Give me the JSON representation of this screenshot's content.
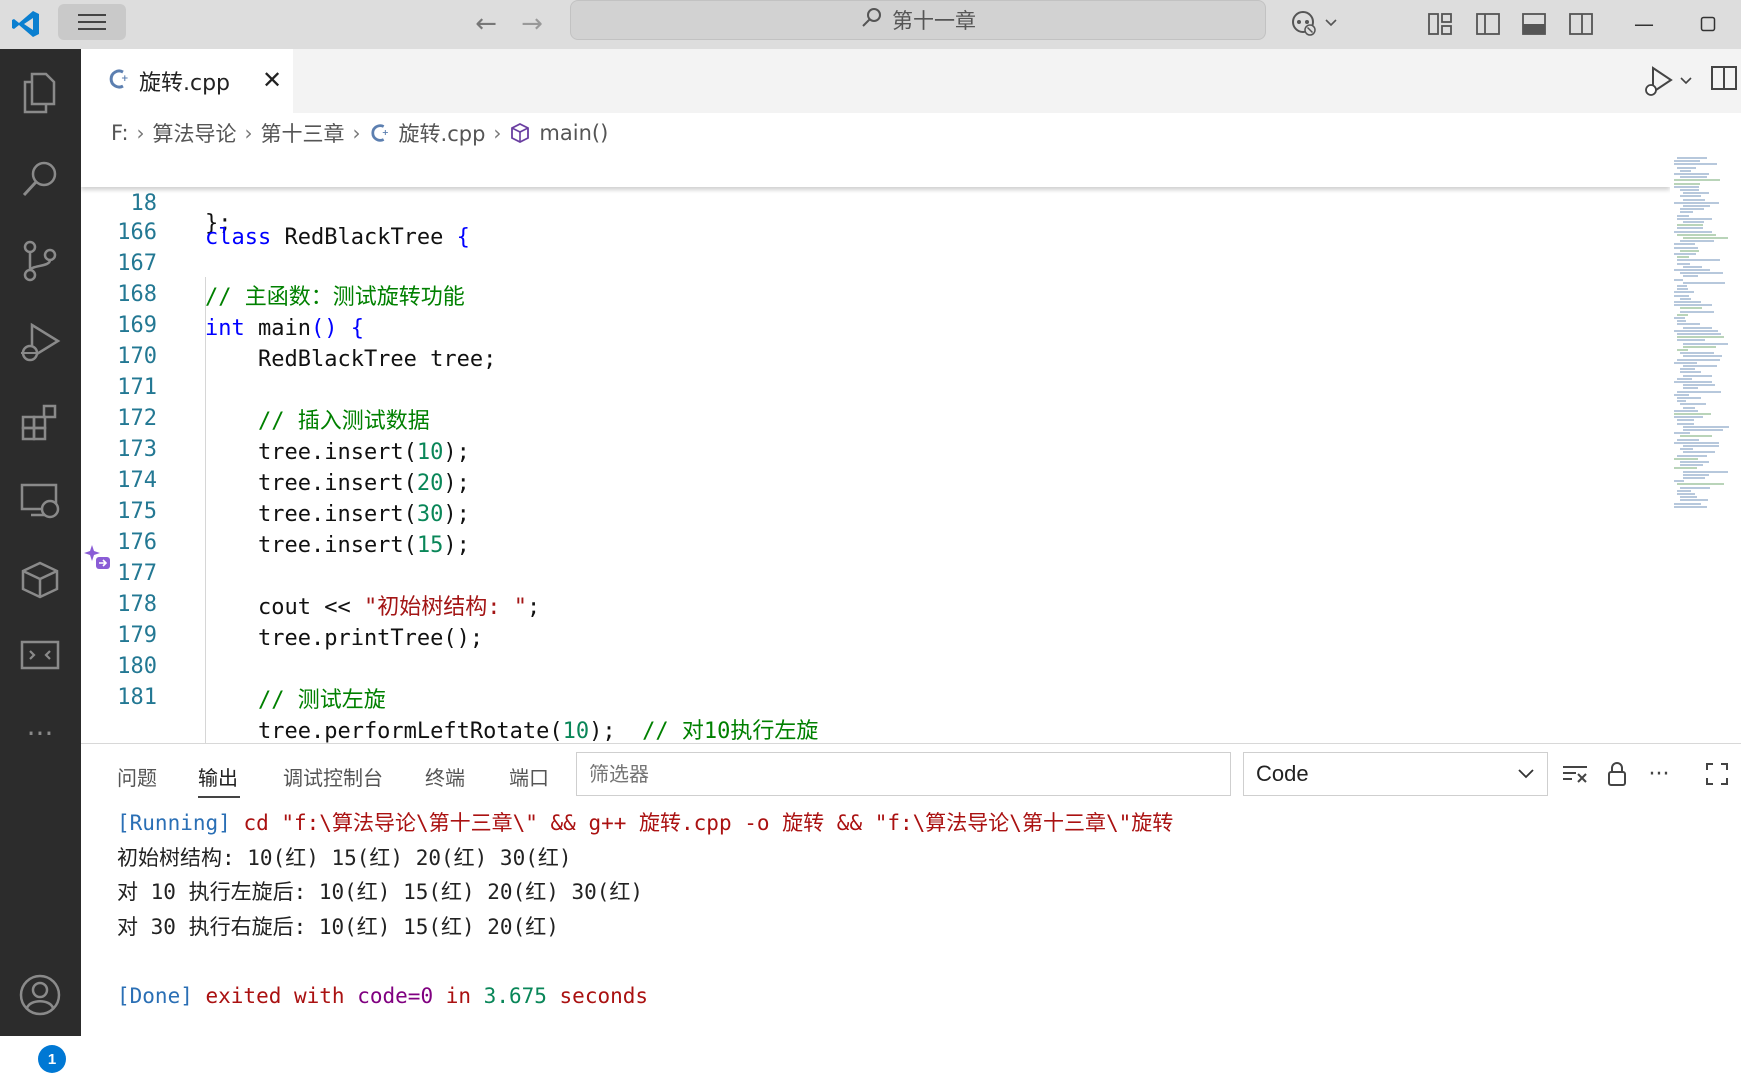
{
  "titlebar": {
    "search_text": "第十一章",
    "icons": [
      "vscode-logo",
      "menu-icon",
      "arrow-left-icon",
      "arrow-right-icon",
      "search-icon",
      "copilot-icon",
      "customize-layout-icon",
      "toggle-sidebar-icon",
      "toggle-panel-icon",
      "toggle-secondary-sidebar-icon",
      "minimize-icon",
      "maximize-icon"
    ]
  },
  "activitybar": {
    "items": [
      "explorer-icon",
      "search-icon",
      "source-control-icon",
      "run-debug-icon",
      "extensions-icon",
      "remote-explorer-icon",
      "containers-icon",
      "remote-window-icon",
      "more-icon",
      "accounts-icon"
    ],
    "accounts_badge": "1"
  },
  "tab": {
    "label": "旋转.cpp",
    "close": "✕"
  },
  "breadcrumb": {
    "drive": "F:",
    "folder1": "算法导论",
    "folder2": "第十三章",
    "file": "旋转.cpp",
    "symbol": "main()"
  },
  "editor": {
    "sticky": {
      "ln": "18",
      "kw": "class",
      "text": " RedBlackTree ",
      "brace": "{"
    },
    "lines": [
      {
        "ln": "166"
      },
      {
        "ln": "167",
        "comment": "// 主函数：测试旋转功能"
      },
      {
        "ln": "168",
        "kw": "int",
        "text": " main",
        "tail": "() {"
      },
      {
        "ln": "169",
        "text": "    RedBlackTree tree;"
      },
      {
        "ln": "170"
      },
      {
        "ln": "171",
        "comment": "    // 插入测试数据"
      },
      {
        "ln": "172",
        "pre": "    tree.insert(",
        "num": "10",
        "post": ");"
      },
      {
        "ln": "173",
        "pre": "    tree.insert(",
        "num": "20",
        "post": ");"
      },
      {
        "ln": "174",
        "pre": "    tree.insert(",
        "num": "30",
        "post": ");"
      },
      {
        "ln": "175",
        "pre": "    tree.insert(",
        "num": "15",
        "post": ");"
      },
      {
        "ln": "176"
      },
      {
        "ln": "177",
        "pre": "    cout << ",
        "str": "\"初始树结构: \"",
        "post": ";"
      },
      {
        "ln": "178",
        "text": "    tree.printTree();"
      },
      {
        "ln": "179"
      },
      {
        "ln": "180",
        "comment": "    // 测试左旋"
      },
      {
        "ln": "181",
        "pre": "    tree.performLeftRotate(",
        "num": "10",
        "post": ");  ",
        "comment2": "// 对10执行左旋"
      }
    ],
    "partial_line": "};"
  },
  "panel": {
    "tabs": [
      "问题",
      "输出",
      "调试控制台",
      "终端",
      "端口"
    ],
    "filter_placeholder": "筛选器",
    "channel": "Code",
    "output": {
      "running_tag": "[Running]",
      "command": " cd \"f:\\算法导论\\第十三章\\\" && g++ 旋转.cpp -o 旋转 && \"f:\\算法导论\\第十三章\\\"旋转",
      "lines": [
        "初始树结构: 10(红) 15(红) 20(红) 30(红)",
        "对 10 执行左旋后: 10(红) 15(红) 20(红) 30(红)",
        "对 30 执行右旋后: 10(红) 15(红) 20(红)"
      ],
      "done_tag": "[Done]",
      "done_pre": " exited with ",
      "done_code": "code=0",
      "done_mid": " in ",
      "done_time": "3.675",
      "done_post": " seconds"
    }
  },
  "colors": {
    "keyword": "#0000ff",
    "comment": "#008000",
    "string": "#a31515",
    "number": "#098658",
    "line_number": "#237893",
    "activity_bg": "#2c2c2c",
    "accent": "#0078d4"
  }
}
